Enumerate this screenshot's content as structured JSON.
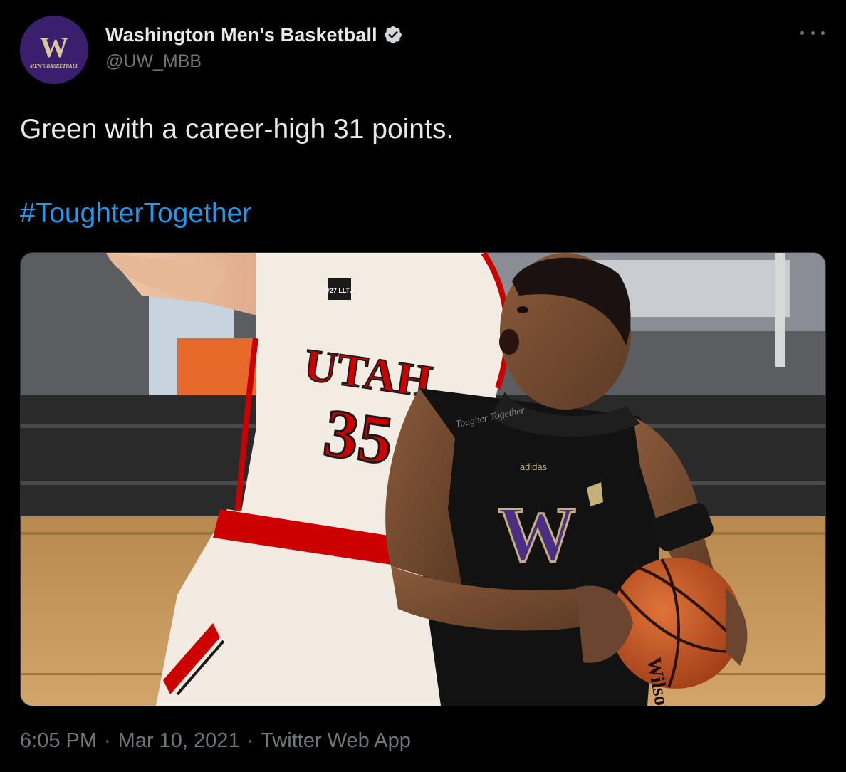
{
  "author": {
    "display_name": "Washington Men's Basketball",
    "handle": "@UW_MBB",
    "verified": true,
    "avatar_letter": "W",
    "avatar_caption": "MEN'S BASKETBALL"
  },
  "tweet": {
    "text": "Green with a career-high 31 points.",
    "hashtag": "#ToughterTogether"
  },
  "media": {
    "jersey_text_utah": "UTAH",
    "jersey_number_utah": "35",
    "jersey_letter_uw": "W",
    "patch_text": "#27 LLTJ",
    "shirt_text": "Tougher Together",
    "brand": "adidas",
    "ball_brand": "Wilson"
  },
  "meta": {
    "time": "6:05 PM",
    "separator": "·",
    "date": "Mar 10, 2021",
    "source": "Twitter Web App"
  },
  "colors": {
    "background": "#000000",
    "text": "#e7e9ea",
    "secondary": "#71767b",
    "link": "#1d9bf0",
    "uw_purple": "#4b2e83",
    "utah_red": "#cc0000"
  }
}
